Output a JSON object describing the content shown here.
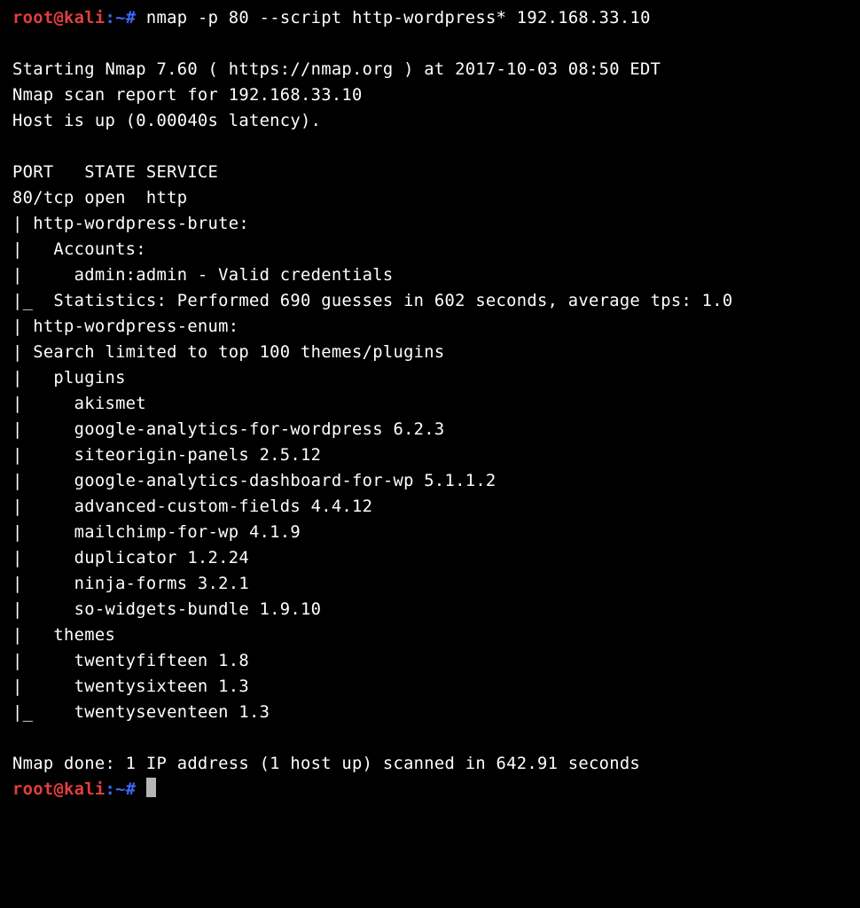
{
  "colors": {
    "user_host": "#e43e3e",
    "symbol": "#3b6bff",
    "fg": "#ffffff",
    "bg": "#000000"
  },
  "prompt1": {
    "user": "root",
    "at": "@",
    "host": "kali",
    "colon": ":",
    "tilde": "~",
    "hash": "#",
    "command": " nmap -p 80 --script http-wordpress* 192.168.33.10"
  },
  "blank1": "",
  "output": {
    "l1": "Starting Nmap 7.60 ( https://nmap.org ) at 2017-10-03 08:50 EDT",
    "l2": "Nmap scan report for 192.168.33.10",
    "l3": "Host is up (0.00040s latency).",
    "blank2": "",
    "l4": "PORT   STATE SERVICE",
    "l5": "80/tcp open  http",
    "l6": "| http-wordpress-brute:",
    "l7": "|   Accounts:",
    "l8": "|     admin:admin - Valid credentials",
    "l9": "|_  Statistics: Performed 690 guesses in 602 seconds, average tps: 1.0",
    "l10": "| http-wordpress-enum:",
    "l11": "| Search limited to top 100 themes/plugins",
    "l12": "|   plugins",
    "l13": "|     akismet",
    "l14": "|     google-analytics-for-wordpress 6.2.3",
    "l15": "|     siteorigin-panels 2.5.12",
    "l16": "|     google-analytics-dashboard-for-wp 5.1.1.2",
    "l17": "|     advanced-custom-fields 4.4.12",
    "l18": "|     mailchimp-for-wp 4.1.9",
    "l19": "|     duplicator 1.2.24",
    "l20": "|     ninja-forms 3.2.1",
    "l21": "|     so-widgets-bundle 1.9.10",
    "l22": "|   themes",
    "l23": "|     twentyfifteen 1.8",
    "l24": "|     twentysixteen 1.3",
    "l25": "|_    twentyseventeen 1.3",
    "blank3": "",
    "l26": "Nmap done: 1 IP address (1 host up) scanned in 642.91 seconds"
  },
  "prompt2": {
    "user": "root",
    "at": "@",
    "host": "kali",
    "colon": ":",
    "tilde": "~",
    "hash": "#",
    "space": " "
  }
}
